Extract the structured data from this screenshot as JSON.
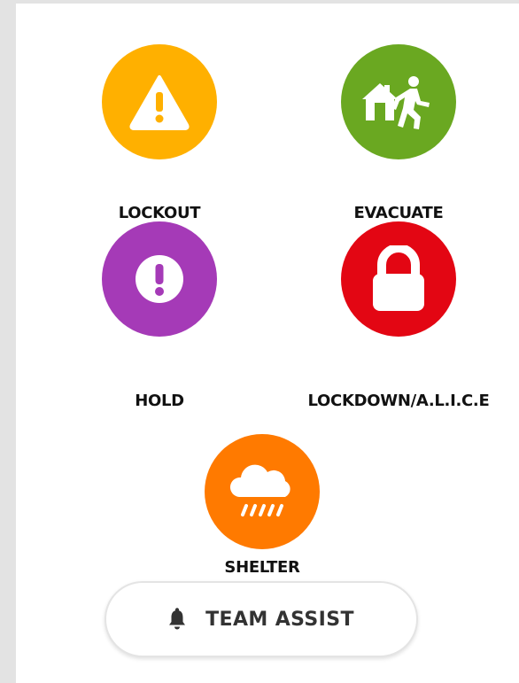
{
  "colors": {
    "lockout": "#FFB000",
    "evacuate": "#6AA821",
    "hold": "#A53AB7",
    "lockdown": "#E30613",
    "shelter": "#FF7A00"
  },
  "actions": {
    "lockout": {
      "label": "LOCKOUT",
      "icon": "warning-triangle-icon"
    },
    "evacuate": {
      "label": "EVACUATE",
      "icon": "person-leaving-house-icon"
    },
    "hold": {
      "label": "HOLD",
      "icon": "exclamation-circle-icon"
    },
    "lockdown": {
      "label": "LOCKDOWN/A.L.I.C.E",
      "icon": "padlock-icon"
    },
    "shelter": {
      "label": "SHELTER",
      "icon": "rain-cloud-icon"
    }
  },
  "team_assist": {
    "label": "TEAM ASSIST",
    "icon": "bell-icon"
  }
}
